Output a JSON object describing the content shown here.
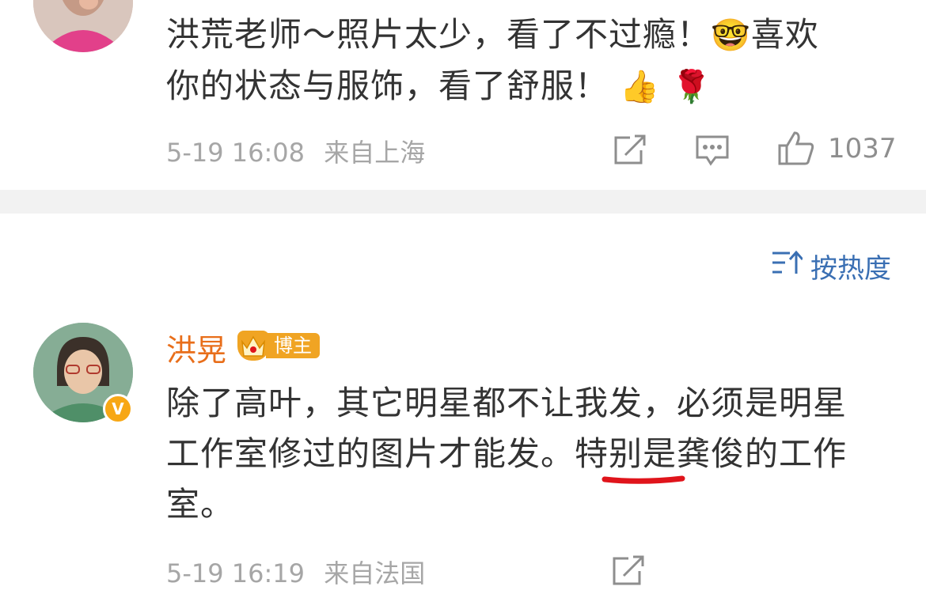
{
  "comment1": {
    "text": "洪荒老师～照片太少，看了不过瘾！",
    "emoji_nerd": "🤓",
    "text_cont1": "喜欢",
    "text_line2": "你的状态与服饰，看了舒服！",
    "emoji_thumbs": "👍",
    "emoji_rose": "🌹",
    "time": "5-19 16:08",
    "location": "来自上海",
    "likes": "1037"
  },
  "sort": {
    "label": "按热度"
  },
  "comment2": {
    "author": "洪晃",
    "badge": "博主",
    "verified_mark": "V",
    "line1": "除了高叶，其它明星都不让我发，必须是明星",
    "line2_a": "工作室修过的图片才能发。",
    "line2_highlight": "特别",
    "line2_b": "是龚俊的工作",
    "line3": "室。",
    "time": "5-19 16:19",
    "location": "来自法国"
  },
  "colors": {
    "accent_orange": "#e86e1a",
    "link_blue": "#3a6fb3",
    "underline_red": "#e0141b",
    "badge_gold": "#f0a423"
  },
  "icons": [
    "share-icon",
    "comment-icon",
    "like-icon",
    "sort-icon",
    "verified-icon",
    "crown-icon"
  ]
}
